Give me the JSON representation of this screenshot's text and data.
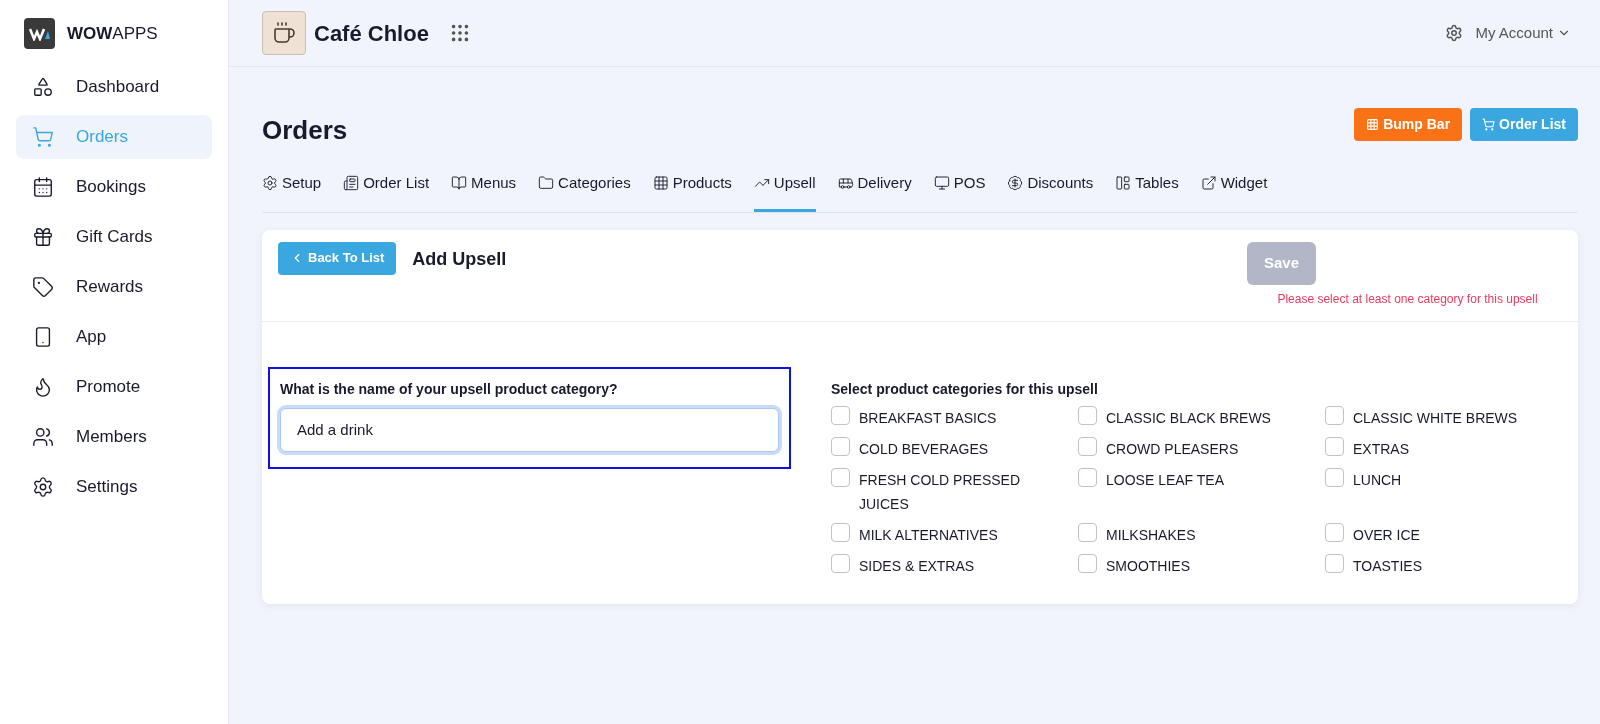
{
  "brand": {
    "bold": "WOW",
    "light": "APPS"
  },
  "sidebar": {
    "items": [
      {
        "label": "Dashboard",
        "selected": false
      },
      {
        "label": "Orders",
        "selected": true
      },
      {
        "label": "Bookings",
        "selected": false
      },
      {
        "label": "Gift Cards",
        "selected": false
      },
      {
        "label": "Rewards",
        "selected": false
      },
      {
        "label": "App",
        "selected": false
      },
      {
        "label": "Promote",
        "selected": false
      },
      {
        "label": "Members",
        "selected": false
      },
      {
        "label": "Settings",
        "selected": false
      }
    ]
  },
  "header": {
    "venue": "Café Chloe",
    "account": "My Account"
  },
  "page": {
    "title": "Orders",
    "buttons": [
      {
        "label": "Bump Bar",
        "kind": "orange"
      },
      {
        "label": "Order List",
        "kind": "blue"
      }
    ]
  },
  "tabs": [
    {
      "label": "Setup",
      "selected": false
    },
    {
      "label": "Order List",
      "selected": false
    },
    {
      "label": "Menus",
      "selected": false
    },
    {
      "label": "Categories",
      "selected": false
    },
    {
      "label": "Products",
      "selected": false
    },
    {
      "label": "Upsell",
      "selected": true
    },
    {
      "label": "Delivery",
      "selected": false
    },
    {
      "label": "POS",
      "selected": false
    },
    {
      "label": "Discounts",
      "selected": false
    },
    {
      "label": "Tables",
      "selected": false
    },
    {
      "label": "Widget",
      "selected": false
    }
  ],
  "card": {
    "back": "Back To List",
    "title": "Add Upsell",
    "save": {
      "label": "Save",
      "disabled": true
    },
    "error": "Please select at least one category for this upsell",
    "name_field": {
      "label": "What is the name of your upsell product category?",
      "value": "Add a drink",
      "focused": true
    },
    "categories_label": "Select product categories for this upsell",
    "categories": [
      {
        "label": "BREAKFAST BASICS",
        "checked": false
      },
      {
        "label": "CLASSIC BLACK BREWS",
        "checked": false
      },
      {
        "label": "CLASSIC WHITE BREWS",
        "checked": false
      },
      {
        "label": "COLD BEVERAGES",
        "checked": false
      },
      {
        "label": "CROWD PLEASERS",
        "checked": false
      },
      {
        "label": "EXTRAS",
        "checked": false
      },
      {
        "label": "FRESH COLD PRESSED JUICES",
        "checked": false
      },
      {
        "label": "LOOSE LEAF TEA",
        "checked": false
      },
      {
        "label": "LUNCH",
        "checked": false
      },
      {
        "label": "MILK ALTERNATIVES",
        "checked": false
      },
      {
        "label": "MILKSHAKES",
        "checked": false
      },
      {
        "label": "OVER ICE",
        "checked": false
      },
      {
        "label": "SIDES & EXTRAS",
        "checked": false
      },
      {
        "label": "SMOOTHIES",
        "checked": false
      },
      {
        "label": "TOASTIES",
        "checked": false
      }
    ]
  }
}
